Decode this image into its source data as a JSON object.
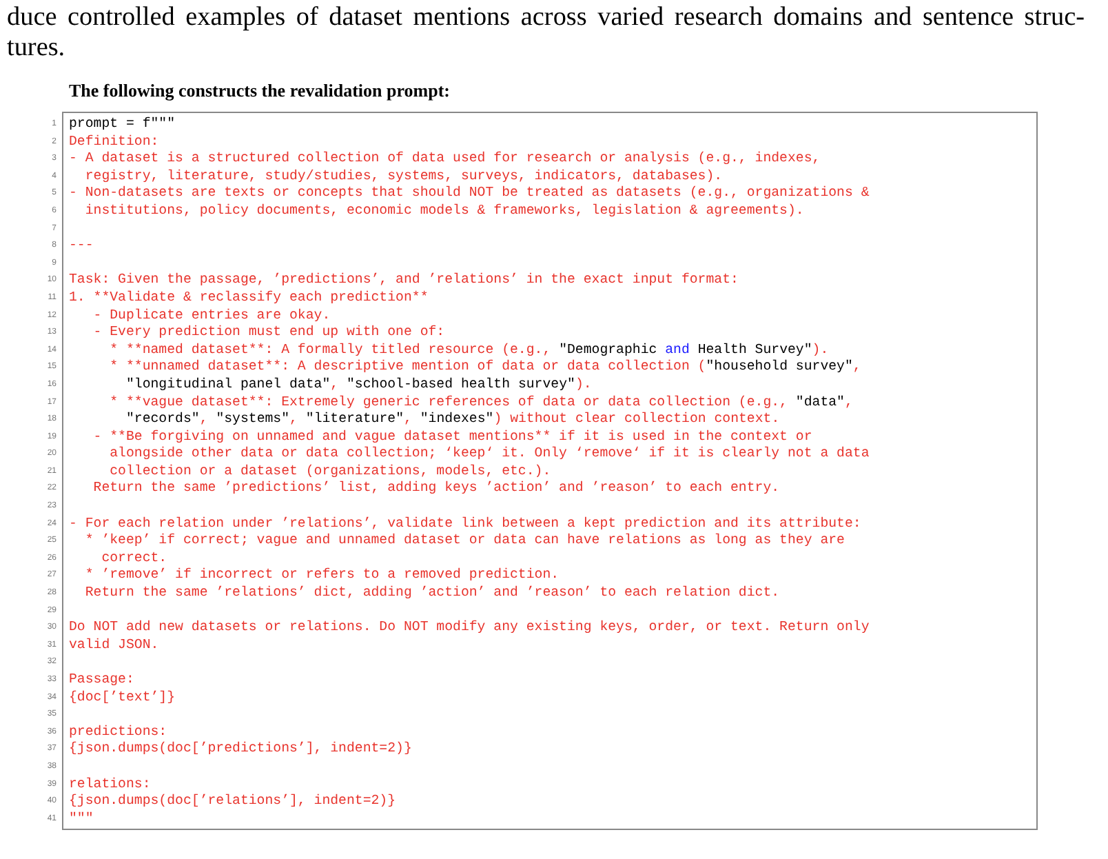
{
  "paragraph_lines": [
    "duce controlled examples of dataset mentions across varied research domains and sentence struc-",
    "tures."
  ],
  "caption": "The following constructs the revalidation prompt:",
  "code_lines": [
    {
      "number": "1",
      "segments": [
        {
          "kind": "plain",
          "text": "prompt = f\"\"\""
        }
      ]
    },
    {
      "number": "2",
      "segments": [
        {
          "kind": "text",
          "text": "Definition:"
        }
      ]
    },
    {
      "number": "3",
      "segments": [
        {
          "kind": "text",
          "text": "- A dataset is a structured collection of data used for research or analysis (e.g., indexes,"
        }
      ]
    },
    {
      "number": "4",
      "segments": [
        {
          "kind": "text",
          "text": "  registry, literature, study/studies, systems, surveys, indicators, databases)."
        }
      ]
    },
    {
      "number": "5",
      "segments": [
        {
          "kind": "text",
          "text": "- Non-datasets are texts or concepts that should NOT be treated as datasets (e.g., organizations &"
        }
      ]
    },
    {
      "number": "6",
      "segments": [
        {
          "kind": "text",
          "text": "  institutions, policy documents, economic models & frameworks, legislation & agreements)."
        }
      ]
    },
    {
      "number": "7"
    },
    {
      "number": "8",
      "segments": [
        {
          "kind": "text",
          "text": "---"
        }
      ]
    },
    {
      "number": "9"
    },
    {
      "number": "10",
      "segments": [
        {
          "kind": "text",
          "text": "Task: Given the passage, ’predictions’, and ’relations’ in the exact input format:"
        }
      ]
    },
    {
      "number": "11",
      "segments": [
        {
          "kind": "text",
          "text": "1. **Validate & reclassify each prediction**"
        }
      ]
    },
    {
      "number": "12",
      "segments": [
        {
          "kind": "text",
          "text": "   - Duplicate entries are okay."
        }
      ]
    },
    {
      "number": "13",
      "segments": [
        {
          "kind": "text",
          "text": "   - Every prediction must end up with one of:"
        }
      ]
    },
    {
      "number": "14",
      "segments": [
        {
          "kind": "text",
          "text": "     * **named dataset**: A formally titled resource (e.g., "
        },
        {
          "kind": "string",
          "text": "\"Demographic "
        },
        {
          "kind": "keyword",
          "text": "and"
        },
        {
          "kind": "string",
          "text": " Health Survey\""
        },
        {
          "kind": "text",
          "text": ")."
        }
      ]
    },
    {
      "number": "15",
      "segments": [
        {
          "kind": "text",
          "text": "     * **unnamed dataset**: A descriptive mention of data or data collection ("
        },
        {
          "kind": "string",
          "text": "\"household survey\""
        },
        {
          "kind": "text",
          "text": ","
        }
      ]
    },
    {
      "number": "16",
      "segments": [
        {
          "kind": "string",
          "text": "       \"longitudinal panel data\""
        },
        {
          "kind": "text",
          "text": ", "
        },
        {
          "kind": "string",
          "text": "\"school-based health survey\""
        },
        {
          "kind": "text",
          "text": ")."
        }
      ]
    },
    {
      "number": "17",
      "segments": [
        {
          "kind": "text",
          "text": "     * **vague dataset**: Extremely generic references of data or data collection (e.g., "
        },
        {
          "kind": "string",
          "text": "\"data\""
        },
        {
          "kind": "text",
          "text": ","
        }
      ]
    },
    {
      "number": "18",
      "segments": [
        {
          "kind": "string",
          "text": "       \"records\""
        },
        {
          "kind": "text",
          "text": ", "
        },
        {
          "kind": "string",
          "text": "\"systems\""
        },
        {
          "kind": "text",
          "text": ", "
        },
        {
          "kind": "string",
          "text": "\"literature\""
        },
        {
          "kind": "text",
          "text": ", "
        },
        {
          "kind": "string",
          "text": "\"indexes\""
        },
        {
          "kind": "text",
          "text": ") without clear collection context."
        }
      ]
    },
    {
      "number": "19",
      "segments": [
        {
          "kind": "text",
          "text": "   - **Be forgiving on unnamed and vague dataset mentions** if it is used in the context or"
        }
      ]
    },
    {
      "number": "20",
      "segments": [
        {
          "kind": "text",
          "text": "     alongside other data or data collection; ‘keep‘ it. Only ‘remove‘ if it is clearly not a data"
        }
      ]
    },
    {
      "number": "21",
      "segments": [
        {
          "kind": "text",
          "text": "     collection or a dataset (organizations, models, etc.)."
        }
      ]
    },
    {
      "number": "22",
      "segments": [
        {
          "kind": "text",
          "text": "   Return the same ’predictions’ list, adding keys ’action’ and ’reason’ to each entry."
        }
      ]
    },
    {
      "number": "23"
    },
    {
      "number": "24",
      "segments": [
        {
          "kind": "text",
          "text": "- For each relation under ’relations’, validate link between a kept prediction and its attribute:"
        }
      ]
    },
    {
      "number": "25",
      "segments": [
        {
          "kind": "text",
          "text": "  * ’keep’ if correct; vague and unnamed dataset or data can have relations as long as they are"
        }
      ]
    },
    {
      "number": "26",
      "segments": [
        {
          "kind": "text",
          "text": "    correct."
        }
      ]
    },
    {
      "number": "27",
      "segments": [
        {
          "kind": "text",
          "text": "  * ’remove’ if incorrect or refers to a removed prediction."
        }
      ]
    },
    {
      "number": "28",
      "segments": [
        {
          "kind": "text",
          "text": "  Return the same ’relations’ dict, adding ’action’ and ’reason’ to each relation dict."
        }
      ]
    },
    {
      "number": "29"
    },
    {
      "number": "30",
      "segments": [
        {
          "kind": "text",
          "text": "Do NOT add new datasets or relations. Do NOT modify any existing keys, order, or text. Return only"
        }
      ]
    },
    {
      "number": "31",
      "segments": [
        {
          "kind": "text",
          "text": "valid JSON."
        }
      ]
    },
    {
      "number": "32"
    },
    {
      "number": "33",
      "segments": [
        {
          "kind": "text",
          "text": "Passage:"
        }
      ]
    },
    {
      "number": "34",
      "segments": [
        {
          "kind": "text",
          "text": "{doc[’text’]}"
        }
      ]
    },
    {
      "number": "35"
    },
    {
      "number": "36",
      "segments": [
        {
          "kind": "text",
          "text": "predictions:"
        }
      ]
    },
    {
      "number": "37",
      "segments": [
        {
          "kind": "text",
          "text": "{json.dumps(doc[’predictions’], indent=2)}"
        }
      ]
    },
    {
      "number": "38"
    },
    {
      "number": "39",
      "segments": [
        {
          "kind": "text",
          "text": "relations:"
        }
      ]
    },
    {
      "number": "40",
      "segments": [
        {
          "kind": "text",
          "text": "{json.dumps(doc[’relations’], indent=2)}"
        }
      ]
    },
    {
      "number": "41",
      "segments": [
        {
          "kind": "text",
          "text": "\"\"\""
        }
      ]
    }
  ]
}
